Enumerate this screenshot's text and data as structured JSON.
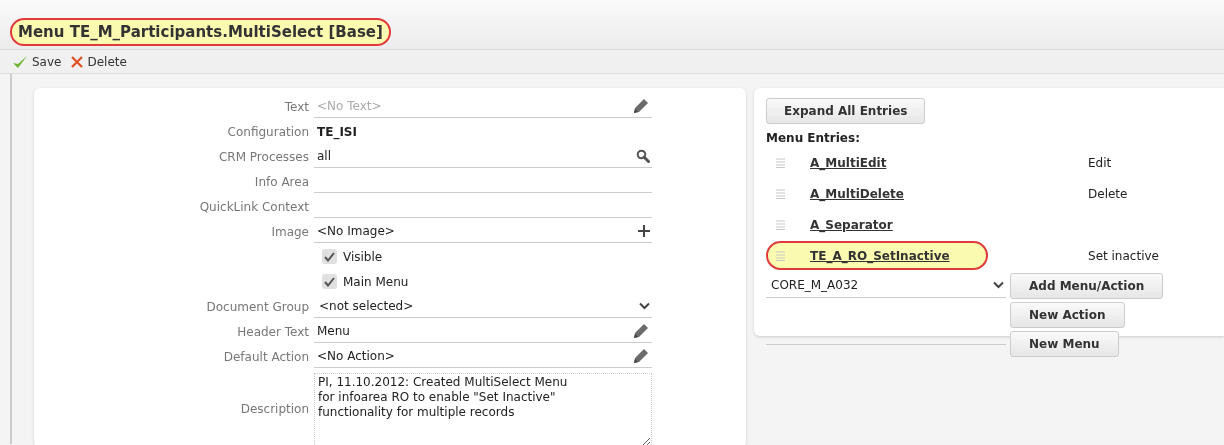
{
  "window": {
    "title": "Menu TE_M_Participants.MultiSelect [Base]",
    "title_highlighted": true
  },
  "toolbar": [
    {
      "kind": "save",
      "label": "Save"
    },
    {
      "kind": "delete",
      "label": "Delete"
    }
  ],
  "form": [
    {
      "kind": "editable",
      "label": "Text",
      "placeholder": "<No Text>"
    },
    {
      "kind": "static",
      "label": "Configuration",
      "value": "TE_ISI"
    },
    {
      "kind": "lookup",
      "label": "CRM Processes",
      "value": "all"
    },
    {
      "kind": "text",
      "label": "Info Area"
    },
    {
      "kind": "text",
      "label": "QuickLink Context"
    },
    {
      "kind": "picker",
      "label": "Image",
      "value": "<No Image>"
    },
    {
      "kind": "checkbox",
      "label": "Visible",
      "checked": true
    },
    {
      "kind": "checkbox",
      "label": "Main Menu",
      "checked": true
    },
    {
      "kind": "select",
      "label": "Document Group",
      "value": "<not selected>"
    },
    {
      "kind": "editable",
      "label": "Header Text",
      "value": "Menu"
    },
    {
      "kind": "editable",
      "label": "Default Action",
      "value": "<No Action>"
    },
    {
      "kind": "textarea",
      "label": "Description",
      "value": "PI, 11.10.2012: Created MultiSelect Menu\nfor infoarea RO to enable \"Set Inactive\"\nfunctionality for multiple records"
    }
  ],
  "menu_panel": {
    "expand_button": "Expand All Entries",
    "heading": "Menu Entries:",
    "entries": [
      {
        "name": "A_MultiEdit",
        "action": "Edit",
        "highlighted": false
      },
      {
        "name": "A_MultiDelete",
        "action": "Delete",
        "highlighted": false
      },
      {
        "name": "A_Separator",
        "highlighted": false
      },
      {
        "name": "TE_A_RO_SetInactive",
        "action": "Set inactive",
        "highlighted": true
      }
    ],
    "add_select": {
      "value": "CORE_M_A032"
    },
    "buttons": [
      "Add Menu/Action",
      "New Action",
      "New Menu"
    ]
  }
}
